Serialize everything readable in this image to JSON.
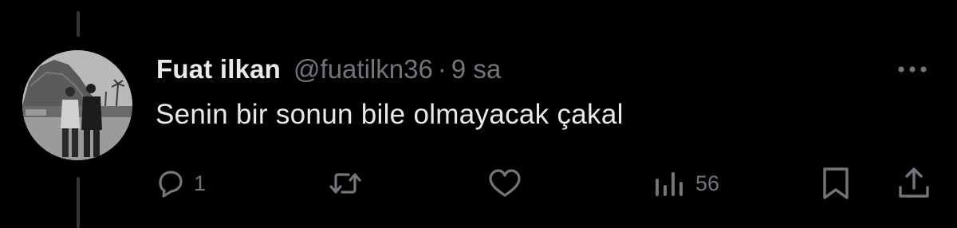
{
  "tweet": {
    "author": {
      "display_name": "Fuat ilkan",
      "handle": "@fuatilkn36"
    },
    "separator": "·",
    "time": "9 sa",
    "text": "Senin bir sonun bile olmayacak çakal"
  },
  "actions": {
    "reply": {
      "icon": "reply-icon",
      "count": "1"
    },
    "retweet": {
      "icon": "retweet-icon",
      "count": ""
    },
    "like": {
      "icon": "heart-icon",
      "count": ""
    },
    "views": {
      "icon": "analytics-icon",
      "count": "56"
    },
    "bookmark": {
      "icon": "bookmark-icon"
    },
    "share": {
      "icon": "share-icon"
    }
  },
  "menu": {
    "icon": "more-dots-icon"
  },
  "colors": {
    "background": "#000000",
    "primary_text": "#e7e9ea",
    "secondary_text": "#71767b",
    "thread_line": "#333639"
  }
}
